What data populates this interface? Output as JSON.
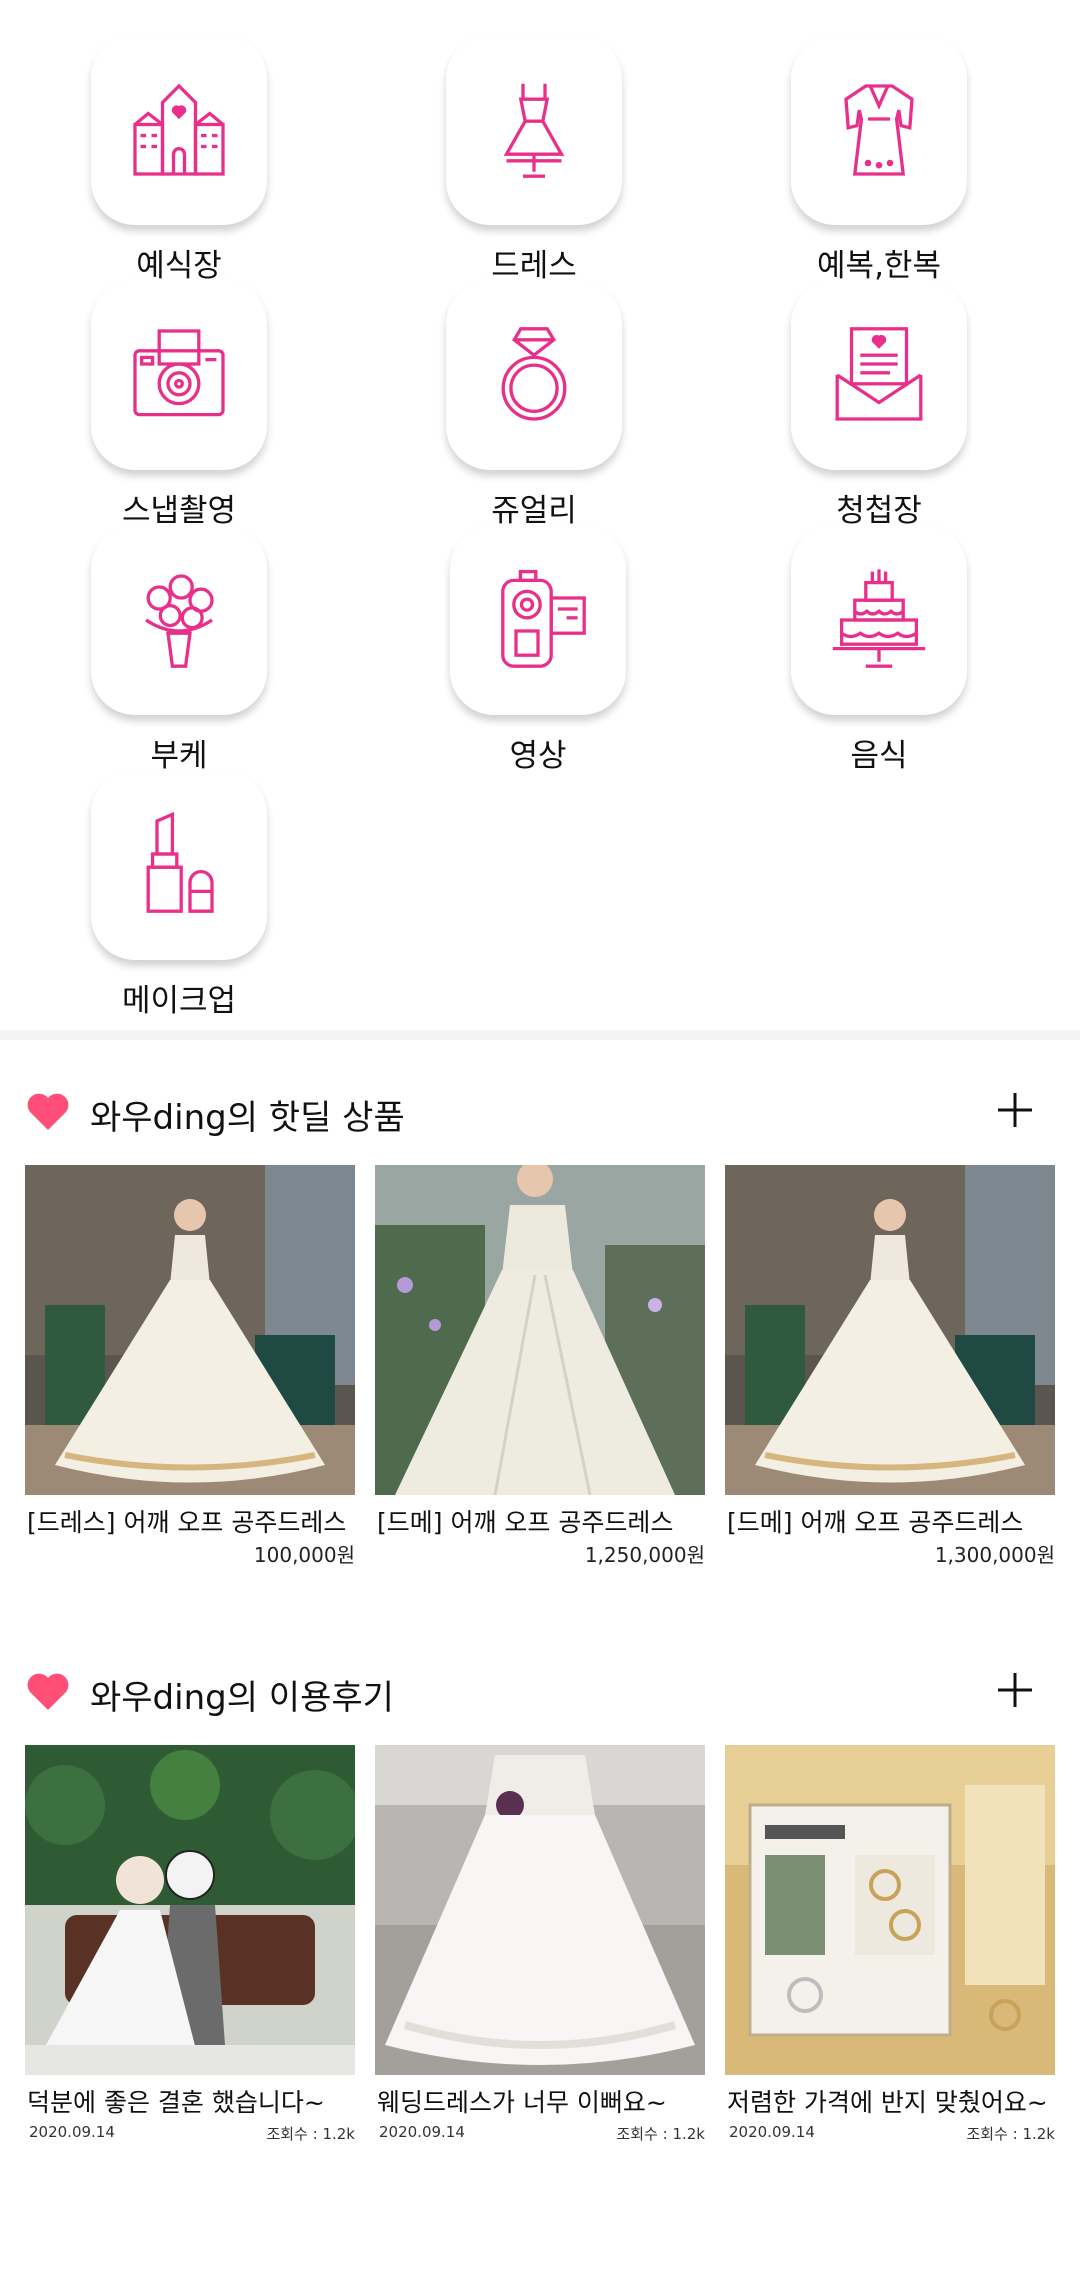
{
  "categories": [
    {
      "label": "예식장",
      "icon": "wedding-hall-icon"
    },
    {
      "label": "드레스",
      "icon": "dress-icon"
    },
    {
      "label": "예복,한복",
      "icon": "hanbok-icon"
    },
    {
      "label": "스냅촬영",
      "icon": "camera-icon"
    },
    {
      "label": "쥬얼리",
      "icon": "ring-icon"
    },
    {
      "label": "청첩장",
      "icon": "invitation-icon"
    },
    {
      "label": "부케",
      "icon": "bouquet-icon"
    },
    {
      "label": "영상",
      "icon": "video-camera-icon"
    },
    {
      "label": "음식",
      "icon": "cake-icon"
    },
    {
      "label": "메이크업",
      "icon": "lipstick-icon"
    }
  ],
  "hot_deals": {
    "title": "와우ding의 핫딜 상품",
    "items": [
      {
        "name": "[드레스] 어깨 오프 공주드레스",
        "price": "100,000원"
      },
      {
        "name": "[드메] 어깨 오프 공주드레스",
        "price": "1,250,000원"
      },
      {
        "name": "[드메] 어깨 오프 공주드레스",
        "price": "1,300,000원"
      }
    ]
  },
  "reviews": {
    "title": "와우ding의 이용후기",
    "items": [
      {
        "title": "덕분에 좋은 결혼 했습니다~",
        "date": "2020.09.14",
        "views": "조회수 : 1.2k"
      },
      {
        "title": "웨딩드레스가 너무 이뻐요~",
        "date": "2020.09.14",
        "views": "조회수 : 1.2k"
      },
      {
        "title": "저렴한 가격에 반지 맞췄어요~",
        "date": "2020.09.14",
        "views": "조회수 : 1.2k"
      }
    ]
  },
  "colors": {
    "accent": "#e8308a",
    "heart": "#ff4f78"
  }
}
